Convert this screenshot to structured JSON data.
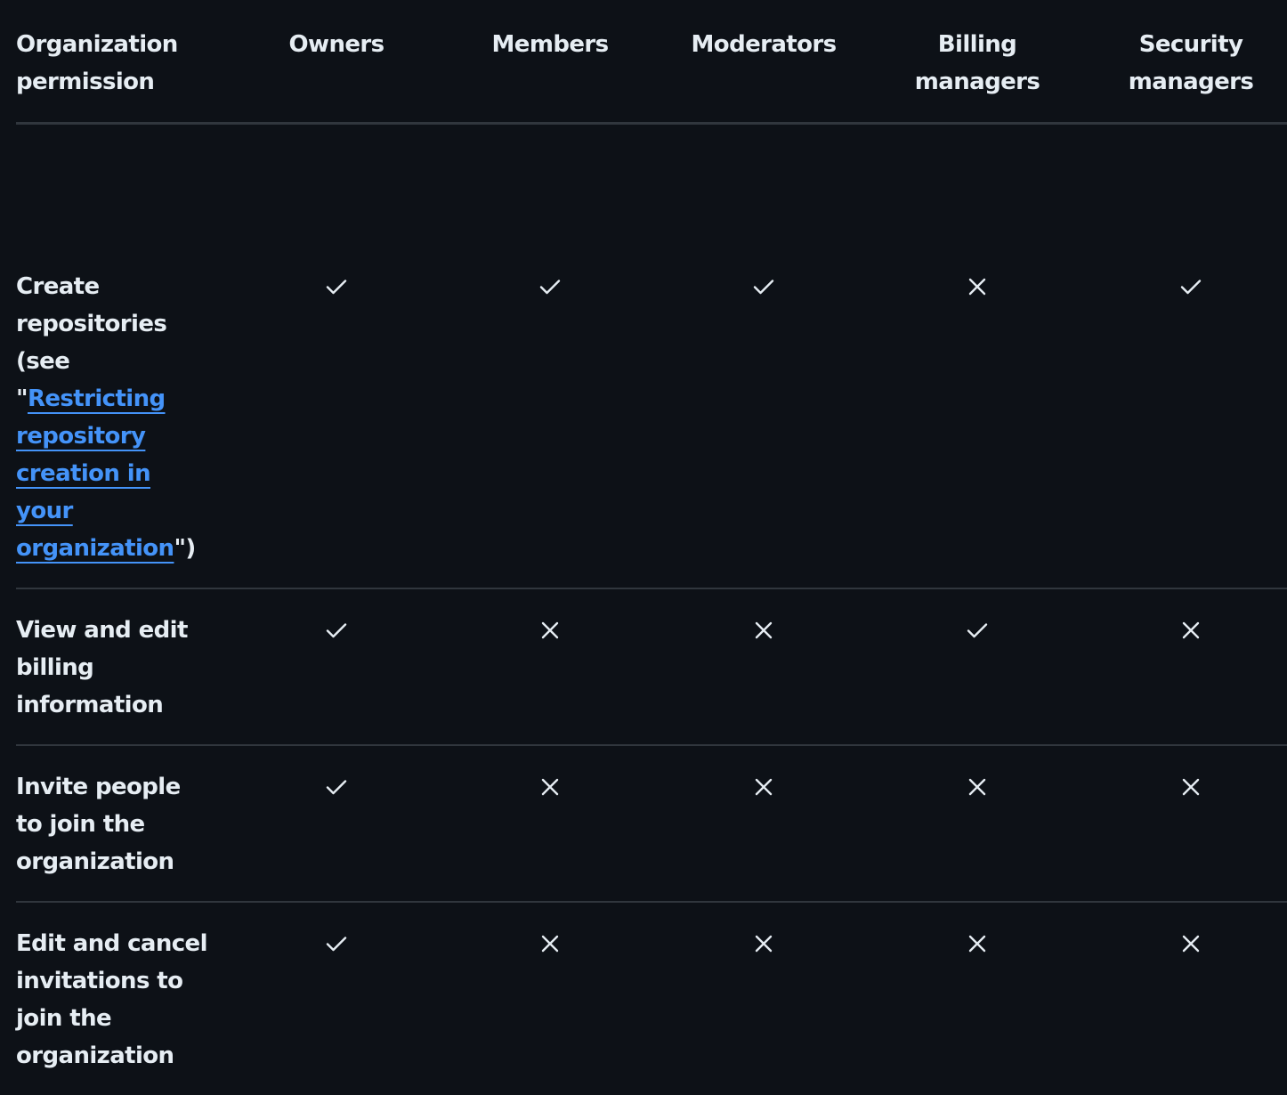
{
  "headers": {
    "permission": "Organization permission",
    "roles": [
      "Owners",
      "Members",
      "Moderators",
      "Billing managers",
      "Security managers"
    ]
  },
  "rows": [
    {
      "pre": "Create repositories (see \"",
      "link": "Restricting repository creation in your organization",
      "post": "\")",
      "values": [
        true,
        true,
        true,
        false,
        true
      ]
    },
    {
      "pre": "View and edit billing information",
      "link": "",
      "post": "",
      "values": [
        true,
        false,
        false,
        true,
        false
      ]
    },
    {
      "pre": "Invite people to join the organization",
      "link": "",
      "post": "",
      "values": [
        true,
        false,
        false,
        false,
        false
      ]
    },
    {
      "pre": "Edit and cancel invitations to join the organization",
      "link": "",
      "post": "",
      "values": [
        true,
        false,
        false,
        false,
        false
      ]
    }
  ],
  "icons": {
    "allowed": "check-icon",
    "denied": "x-icon"
  },
  "colors": {
    "background": "#0d1117",
    "text": "#e6edf3",
    "link": "#4493f8",
    "border": "#30363d"
  }
}
